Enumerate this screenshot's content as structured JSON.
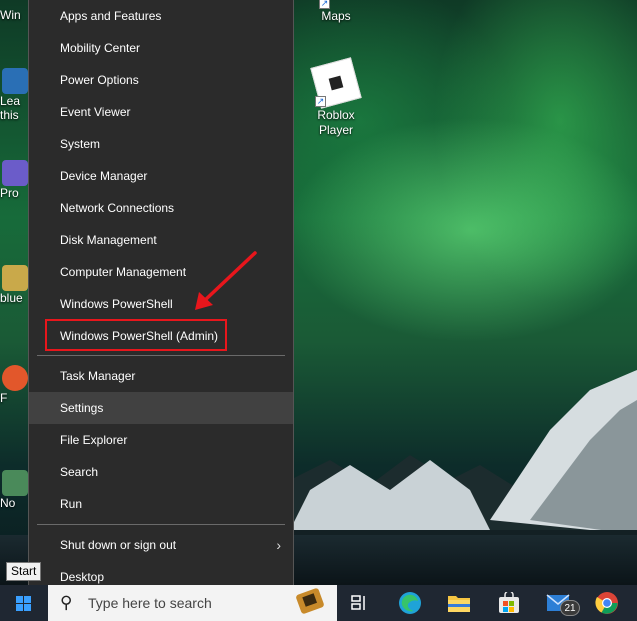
{
  "menu": {
    "items": [
      {
        "label": "Apps and Features"
      },
      {
        "label": "Mobility Center"
      },
      {
        "label": "Power Options"
      },
      {
        "label": "Event Viewer"
      },
      {
        "label": "System"
      },
      {
        "label": "Device Manager"
      },
      {
        "label": "Network Connections"
      },
      {
        "label": "Disk Management"
      },
      {
        "label": "Computer Management"
      },
      {
        "label": "Windows PowerShell"
      },
      {
        "label": "Windows PowerShell (Admin)"
      },
      {
        "label": "Task Manager"
      },
      {
        "label": "Settings"
      },
      {
        "label": "File Explorer"
      },
      {
        "label": "Search"
      },
      {
        "label": "Run"
      },
      {
        "label": "Shut down or sign out"
      },
      {
        "label": "Desktop"
      }
    ],
    "highlighted_item": "Windows PowerShell (Admin)",
    "hovered_item": "Settings"
  },
  "desktop": {
    "icons": [
      {
        "label": "Maps"
      },
      {
        "label": "Roblox Player"
      }
    ],
    "left_edge_labels": [
      "Win",
      "Lea",
      "this",
      "Pro",
      "blue",
      "F",
      "No"
    ]
  },
  "tooltip": {
    "text": "Start"
  },
  "taskbar": {
    "search_placeholder": "Type here to search",
    "mail_badge": "21",
    "apps": [
      "task-view",
      "edge",
      "file-explorer",
      "microsoft-store",
      "mail",
      "chrome"
    ]
  },
  "annotation": {
    "color": "#e8161c"
  }
}
